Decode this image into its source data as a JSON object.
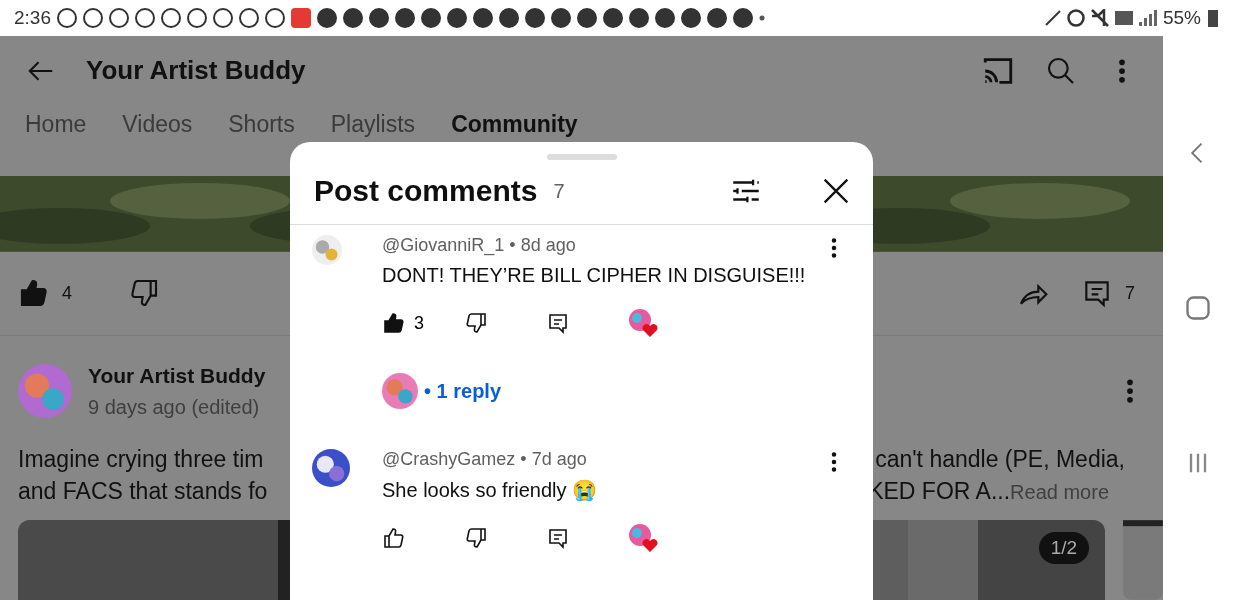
{
  "status_bar": {
    "time": "2:36",
    "battery": "55%"
  },
  "channel": {
    "title": "Your Artist Buddy"
  },
  "tabs": [
    {
      "label": "Home",
      "selected": false
    },
    {
      "label": "Videos",
      "selected": false
    },
    {
      "label": "Shorts",
      "selected": false
    },
    {
      "label": "Playlists",
      "selected": false
    },
    {
      "label": "Community",
      "selected": true
    }
  ],
  "post_actions": {
    "likes": "4",
    "liked": true,
    "comments": "7"
  },
  "post": {
    "author": "Your Artist Buddy",
    "time": "9 days ago (edited)",
    "lines": [
      {
        "left": "Imagine crying three tim",
        "right": "can't handle (PE, Media,"
      },
      {
        "left": "and FACS that stands fo",
        "right": "KED FOR A...",
        "more": "Read more"
      }
    ],
    "image_badge": "1/2"
  },
  "sheet": {
    "title": "Post comments",
    "count": "7",
    "comments": [
      {
        "author": "@GiovanniR_1",
        "separator": "•",
        "time": "8d ago",
        "text": "DONT! THEY’RE BILL CIPHER IN DISGUISE!!!",
        "liked": true,
        "likes": "3",
        "hearted": true,
        "replies": "• 1 reply"
      },
      {
        "author": "@CrashyGamez",
        "separator": "•",
        "time": "7d ago",
        "text": "She looks so friendly 😭",
        "liked": false,
        "hearted": true
      }
    ]
  }
}
